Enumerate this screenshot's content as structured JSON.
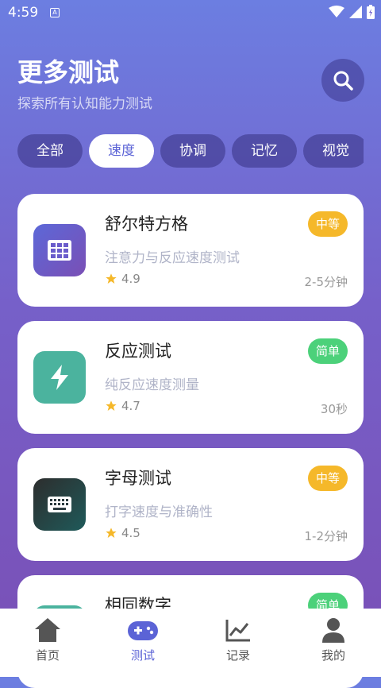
{
  "status": {
    "time": "4:59",
    "sim": "A"
  },
  "header": {
    "title": "更多测试",
    "subtitle": "探索所有认知能力测试"
  },
  "chips": [
    "全部",
    "速度",
    "协调",
    "记忆",
    "视觉"
  ],
  "tests": [
    {
      "name": "舒尔特方格",
      "desc": "注意力与反应速度测试",
      "rating": "4.9",
      "duration": "2-5分钟",
      "level": "中等",
      "level_color": "#f5b82a",
      "icon": "grid-icon",
      "icon_bg": "#6a55c0"
    },
    {
      "name": "反应测试",
      "desc": "纯反应速度测量",
      "rating": "4.7",
      "duration": "30秒",
      "level": "简单",
      "level_color": "#4cd17a",
      "icon": "lightning-icon",
      "icon_bg": "#4bb39e"
    },
    {
      "name": "字母测试",
      "desc": "打字速度与准确性",
      "rating": "4.5",
      "duration": "1-2分钟",
      "level": "中等",
      "level_color": "#f5b82a",
      "icon": "keyboard-icon",
      "icon_bg": "#243b42"
    },
    {
      "name": "相同数字",
      "desc": "",
      "rating": "",
      "duration": "",
      "level": "简单",
      "level_color": "#4cd17a",
      "icon": "numbers-icon",
      "icon_bg": "#4bb39e"
    }
  ],
  "nav": [
    {
      "label": "首页",
      "icon": "home-icon"
    },
    {
      "label": "测试",
      "icon": "gamepad-icon"
    },
    {
      "label": "记录",
      "icon": "chart-icon"
    },
    {
      "label": "我的",
      "icon": "user-icon"
    }
  ],
  "colors": {
    "accent": "#5b63d6",
    "star": "#f5b82a"
  }
}
